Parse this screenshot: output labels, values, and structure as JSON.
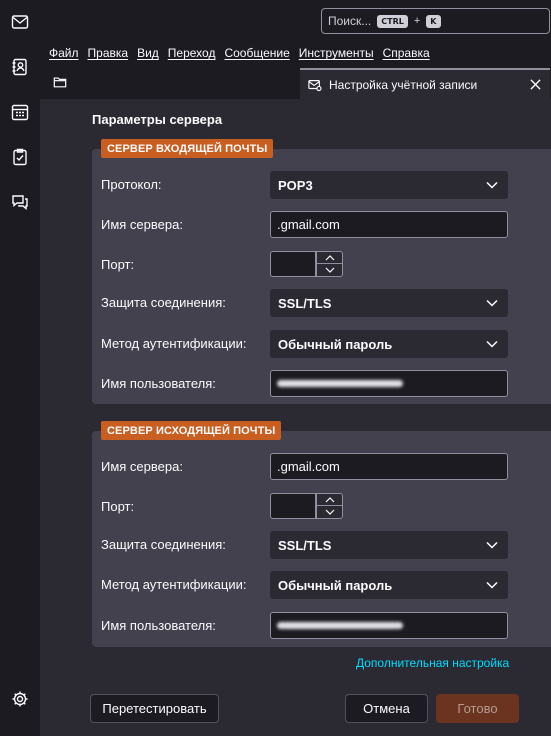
{
  "search": {
    "placeholder": "Поиск...",
    "key1": "CTRL",
    "plus": "+",
    "key2": "K"
  },
  "menu": [
    "Файл",
    "Правка",
    "Вид",
    "Переход",
    "Сообщение",
    "Инструменты",
    "Справка"
  ],
  "tab": {
    "title": "Настройка учётной записи"
  },
  "page": {
    "title": "Параметры сервера"
  },
  "incoming": {
    "legend": "СЕРВЕР ВХОДЯЩЕЙ ПОЧТЫ",
    "protocol_label": "Протокол:",
    "protocol_value": "POP3",
    "server_label": "Имя сервера:",
    "server_value": ".gmail.com",
    "port_label": "Порт:",
    "security_label": "Защита соединения:",
    "security_value": "SSL/TLS",
    "auth_label": "Метод аутентификации:",
    "auth_value": "Обычный пароль",
    "user_label": "Имя пользователя:"
  },
  "outgoing": {
    "legend": "СЕРВЕР ИСХОДЯЩЕЙ ПОЧТЫ",
    "server_label": "Имя сервера:",
    "server_value": ".gmail.com",
    "port_label": "Порт:",
    "security_label": "Защита соединения:",
    "security_value": "SSL/TLS",
    "auth_label": "Метод аутентификации:",
    "auth_value": "Обычный пароль",
    "user_label": "Имя пользователя:"
  },
  "advanced_link": "Дополнительная настройка",
  "buttons": {
    "retest": "Перетестировать",
    "cancel": "Отмена",
    "done": "Готово"
  },
  "colors": {
    "accent": "#c85e1f",
    "link": "#00ddff",
    "panel": "#42414d",
    "background": "#2b2a33"
  }
}
